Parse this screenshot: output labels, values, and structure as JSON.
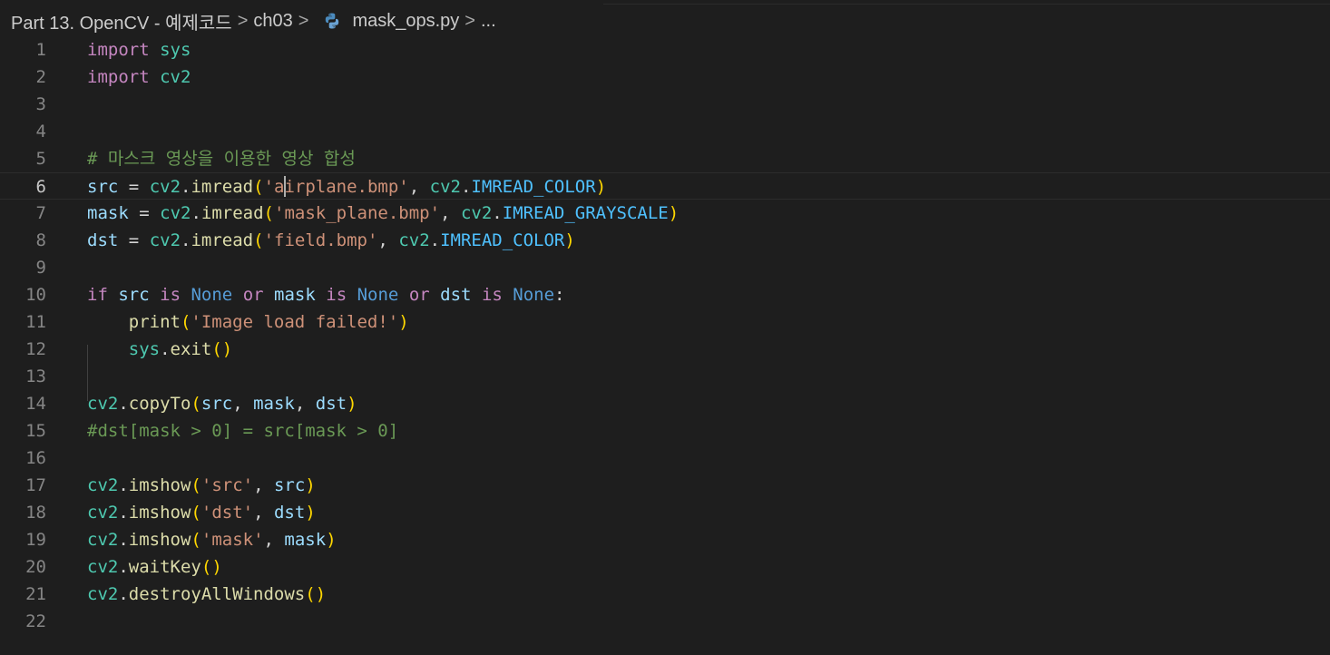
{
  "breadcrumb": {
    "root": "Part 13. OpenCV - 예제코드",
    "folder": "ch03",
    "file": "mask_ops.py",
    "more": "...",
    "separator": ">"
  },
  "editor": {
    "current_line": 6,
    "lines": [
      {
        "n": "1",
        "text": "import sys"
      },
      {
        "n": "2",
        "text": "import cv2"
      },
      {
        "n": "3",
        "text": ""
      },
      {
        "n": "4",
        "text": ""
      },
      {
        "n": "5",
        "text": "# 마스크 영상을 이용한 영상 합성"
      },
      {
        "n": "6",
        "text": "src = cv2.imread('airplane.bmp', cv2.IMREAD_COLOR)"
      },
      {
        "n": "7",
        "text": "mask = cv2.imread('mask_plane.bmp', cv2.IMREAD_GRAYSCALE)"
      },
      {
        "n": "8",
        "text": "dst = cv2.imread('field.bmp', cv2.IMREAD_COLOR)"
      },
      {
        "n": "9",
        "text": ""
      },
      {
        "n": "10",
        "text": "if src is None or mask is None or dst is None:"
      },
      {
        "n": "11",
        "text": "    print('Image load failed!')"
      },
      {
        "n": "12",
        "text": "    sys.exit()"
      },
      {
        "n": "13",
        "text": ""
      },
      {
        "n": "14",
        "text": "cv2.copyTo(src, mask, dst)"
      },
      {
        "n": "15",
        "text": "#dst[mask > 0] = src[mask > 0]"
      },
      {
        "n": "16",
        "text": ""
      },
      {
        "n": "17",
        "text": "cv2.imshow('src', src)"
      },
      {
        "n": "18",
        "text": "cv2.imshow('dst', dst)"
      },
      {
        "n": "19",
        "text": "cv2.imshow('mask', mask)"
      },
      {
        "n": "20",
        "text": "cv2.waitKey()"
      },
      {
        "n": "21",
        "text": "cv2.destroyAllWindows()"
      },
      {
        "n": "22",
        "text": ""
      }
    ]
  },
  "colors": {
    "background": "#1e1e1e",
    "keyword": "#c586c0",
    "keyword_blue": "#569cd6",
    "variable": "#9cdcfe",
    "module": "#4ec9b0",
    "function": "#dcdcaa",
    "string": "#ce9178",
    "constant": "#4fc1ff",
    "comment": "#6a9955",
    "line_number": "#858585"
  },
  "icons": {
    "file_type": "python-icon",
    "separator": "chevron-right-icon"
  }
}
